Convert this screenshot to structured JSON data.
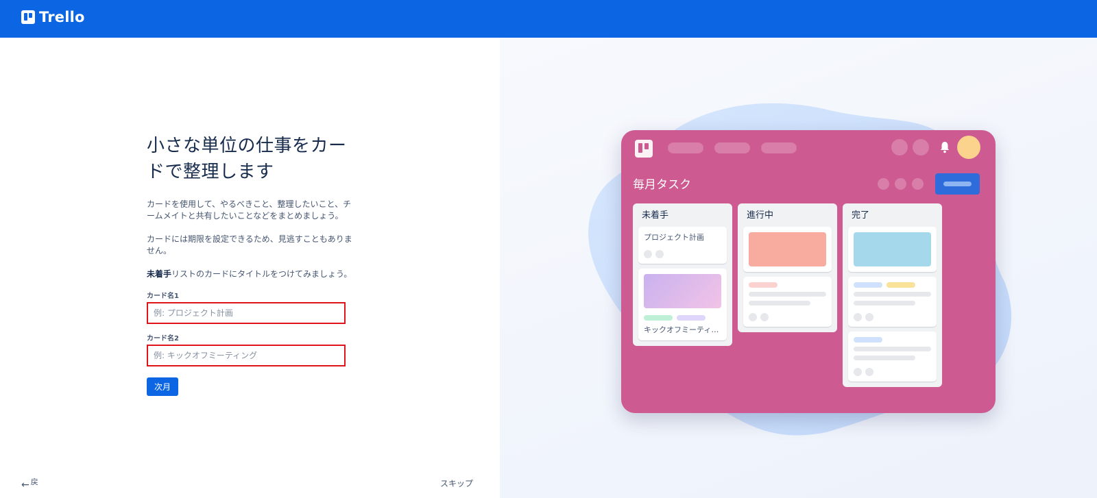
{
  "header": {
    "logo_text": "Trello"
  },
  "main": {
    "heading": "小さな単位の仕事をカードで整理します",
    "paragraph_1": "カードを使用して、やるべきこと、整理したいこと、チームメイトと共有したいことなどをまとめましょう。",
    "paragraph_2": "カードには期限を設定できるため、見逃すこともありません。",
    "paragraph_3_bold": "未着手",
    "paragraph_3_rest": "リストのカードにタイトルをつけてみましょう。",
    "field_1": {
      "label": "カード名1",
      "placeholder": "例: プロジェクト計画",
      "value": ""
    },
    "field_2": {
      "label": "カード名2",
      "placeholder": "例: キックオフミーティング",
      "value": ""
    },
    "next_button": "次月"
  },
  "footer": {
    "back_label": "戻",
    "skip_label": "スキップ"
  },
  "illustration": {
    "board_title": "毎月タスク",
    "board_color": "#cd5a91",
    "lists": [
      {
        "title": "未着手",
        "cards": [
          "プロジェクト計画",
          "キックオフミーティング"
        ]
      },
      {
        "title": "進行中"
      },
      {
        "title": "完了"
      }
    ],
    "colors": {
      "brand": "#0c66e4",
      "highlight_border": "#e0131b",
      "avatar": "#fbd38d"
    }
  }
}
